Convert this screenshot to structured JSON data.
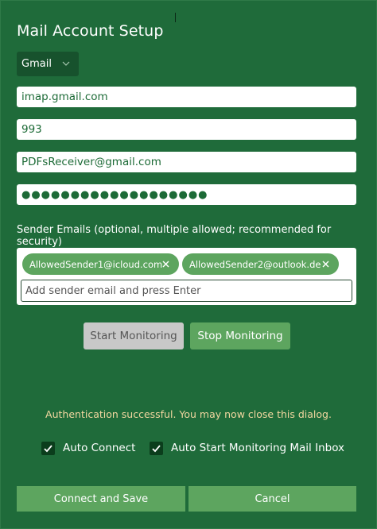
{
  "dialog": {
    "title": "Mail Account Setup"
  },
  "provider": {
    "selected": "Gmail"
  },
  "fields": {
    "imap_server": "imap.gmail.com",
    "port": "993",
    "email": "PDFsReceiver@gmail.com",
    "password_mask": "●●●●●●●●●●●●●●●●●●●"
  },
  "senders": {
    "label": "Sender Emails (optional, multiple allowed; recommended for security)",
    "chips": [
      "AllowedSender1@icloud.com",
      "AllowedSender2@outlook.de"
    ],
    "placeholder": "Add sender email and press Enter"
  },
  "monitoring": {
    "start_label": "Start Monitoring",
    "stop_label": "Stop Monitoring"
  },
  "status": {
    "message": "Authentication successful. You may now close this dialog."
  },
  "options": {
    "auto_connect": {
      "label": "Auto Connect",
      "checked": true
    },
    "auto_start": {
      "label": "Auto Start Monitoring Mail Inbox",
      "checked": true
    }
  },
  "footer": {
    "connect_label": "Connect and Save",
    "cancel_label": "Cancel"
  },
  "colors": {
    "background": "#1f6b3a",
    "accent": "#5da55f",
    "status_text": "#f2d7a0"
  }
}
